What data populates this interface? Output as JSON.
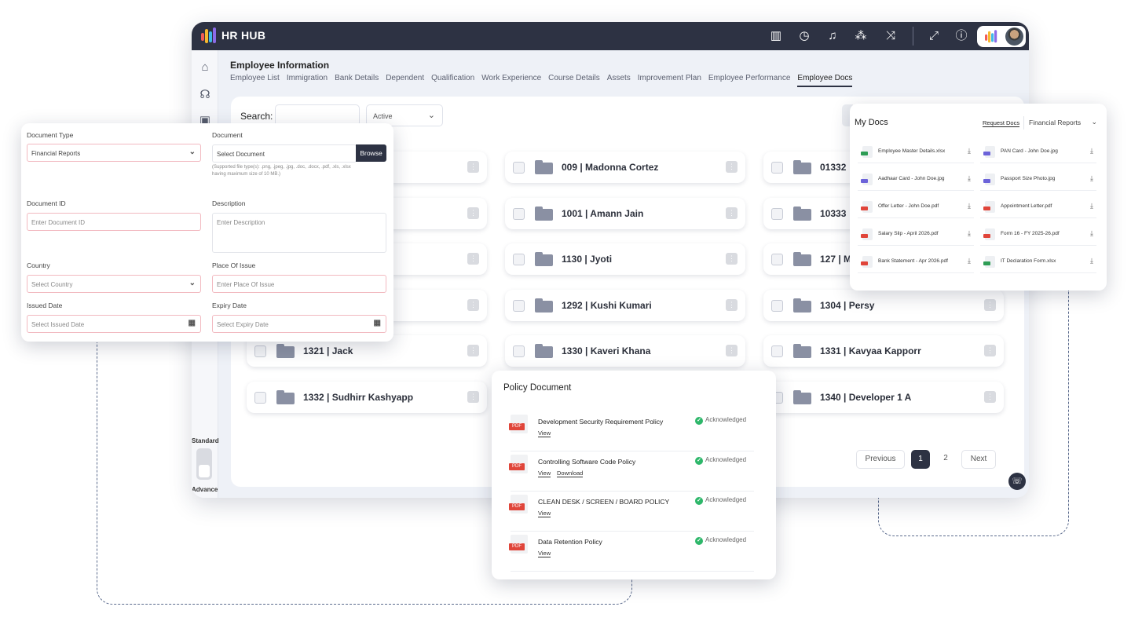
{
  "app": {
    "brand": "HR HUB",
    "page_title": "Employee Information",
    "tabs": [
      "Employee List",
      "Immigration",
      "Bank Details",
      "Dependent",
      "Qualification",
      "Work Experience",
      "Course Details",
      "Assets",
      "Improvement Plan",
      "Employee Performance",
      "Employee Docs"
    ],
    "active_tab": "Employee Docs",
    "topbar_icons": [
      "book-icon",
      "history-icon",
      "bell-icon",
      "network-icon",
      "shuffle-icon",
      "expand-icon",
      "help-icon"
    ],
    "sidebar": {
      "standard_label": "Standard",
      "advance_label": "Advance",
      "icons": [
        "home-icon",
        "user-icon",
        "briefcase-icon"
      ]
    },
    "search_label": "Search:",
    "status_value": "Active",
    "folders": [
      [
        "",
        "009 | Madonna Cortez",
        "01332"
      ],
      [
        "",
        "1001 | Amann Jain",
        "10333"
      ],
      [
        "",
        "1130 | Jyoti",
        "127 | M"
      ],
      [
        "",
        "1292 | Kushi Kumari",
        "1304 | Persy"
      ],
      [
        "1321 | Jack",
        "1330 | Kaveri Khana",
        "1331 | Kavyaa Kapporr"
      ],
      [
        "1332 | Sudhirr Kashyapp",
        "",
        "1340 | Developer 1 A"
      ]
    ],
    "pagination": {
      "previous": "Previous",
      "pages": [
        "1",
        "2"
      ],
      "current": "1",
      "next": "Next"
    }
  },
  "doc_form": {
    "document_type_label": "Document Type",
    "document_type_value": "Financial Reports",
    "document_label": "Document",
    "document_placeholder": "Select Document",
    "browse_label": "Browse",
    "hint_line1": "(Supported file type(s): .png, .jpeg, .jpg, .doc, .docx, .pdf, .xls, .xlsx",
    "hint_line2": "having maximum size of 10 MB.)",
    "document_id_label": "Document ID",
    "document_id_placeholder": "Enter Document ID",
    "description_label": "Description",
    "description_placeholder": "Enter Description",
    "country_label": "Country",
    "country_placeholder": "Select Country",
    "place_label": "Place Of Issue",
    "place_placeholder": "Enter Place Of Issue",
    "issued_label": "Issued Date",
    "issued_placeholder": "Select Issued Date",
    "expiry_label": "Expiry Date",
    "expiry_placeholder": "Select Expiry Date"
  },
  "my_docs": {
    "title": "My Docs",
    "request_label": "Request Docs",
    "category": "Financial Reports",
    "items": [
      {
        "name": "Employee Master Details.xlsx",
        "type": "xls"
      },
      {
        "name": "PAN Card - John Doe.jpg",
        "type": "img"
      },
      {
        "name": "Aadhaar Card - John Doe.jpg",
        "type": "img"
      },
      {
        "name": "Passport Size Photo.jpg",
        "type": "img"
      },
      {
        "name": "Offer Letter - John Doe.pdf",
        "type": "pdf"
      },
      {
        "name": "Appointment Letter.pdf",
        "type": "pdf"
      },
      {
        "name": "Salary Slip - April 2026.pdf",
        "type": "pdf"
      },
      {
        "name": "Form 16 - FY 2025-26.pdf",
        "type": "pdf"
      },
      {
        "name": "Bank Statement - Apr 2026.pdf",
        "type": "pdf"
      },
      {
        "name": "IT Declaration Form.xlsx",
        "type": "xls"
      }
    ],
    "colors": {
      "pdf": "#e0453a",
      "xls": "#2e9d55",
      "img": "#6c63d9"
    }
  },
  "policy": {
    "title": "Policy Document",
    "status_label": "Acknowledged",
    "view_label": "View",
    "download_label": "Download",
    "items": [
      {
        "name": "Development Security Requirement Policy",
        "download": false
      },
      {
        "name": "Controlling Software Code Policy",
        "download": true
      },
      {
        "name": "CLEAN DESK / SCREEN / BOARD POLICY",
        "download": false
      },
      {
        "name": "Data Retention Policy",
        "download": false
      }
    ]
  }
}
